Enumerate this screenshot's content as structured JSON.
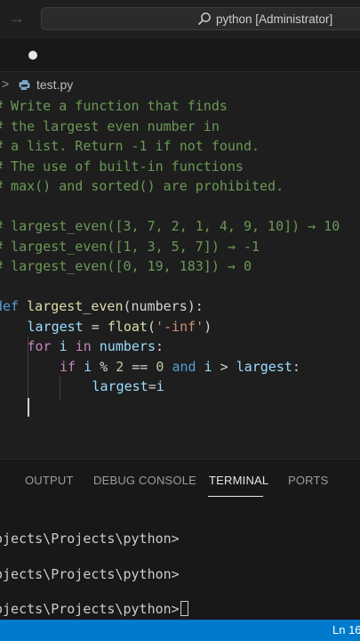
{
  "title_bar": {
    "search_text": "python [Administrator]",
    "nav_icon": "arrow-right-icon",
    "search_icon": "search-icon"
  },
  "tab": {
    "indicator": "unsaved-dot"
  },
  "breadcrumb": {
    "file": "test.py",
    "chevron": ">",
    "file_icon": "python-file-icon"
  },
  "editor": {
    "comments": [
      "# Write a function that finds",
      "# the largest even number in",
      "# a list. Return -1 if not found.",
      "# The use of built-in functions",
      "# max() and sorted() are prohibited.",
      "# largest_even([3, 7, 2, 1, 4, 9, 10]) → 10",
      "# largest_even([1, 3, 5, 7]) → -1",
      "# largest_even([0, 19, 183]) → 0"
    ],
    "def_kw": "def",
    "func_name": "largest_even",
    "def_params": "(numbers):",
    "l2_var": "largest",
    "l2_eq": " = ",
    "l2_func": "float",
    "l2_open": "(",
    "l2_str": "'-inf'",
    "l2_close": ")",
    "l3_for": "for",
    "l3_i": "i",
    "l3_in": "in",
    "l3_numbers": "numbers",
    "l3_colon": ":",
    "l4_if": "if",
    "l4_i": "i",
    "l4_mod": " % ",
    "l4_two": "2",
    "l4_eq": " == ",
    "l4_zero": "0",
    "l4_and": "and",
    "l4_i2": "i",
    "l4_gt": " > ",
    "l4_largest": "largest",
    "l4_colon": ":",
    "l5_largest": "largest",
    "l5_eq": "=",
    "l5_i": "i"
  },
  "panel": {
    "tabs": [
      "OUTPUT",
      "DEBUG CONSOLE",
      "TERMINAL",
      "PORTS"
    ],
    "active_tab": "TERMINAL",
    "terminal_lines": [
      "ojects\\Projects\\python>",
      "ojects\\Projects\\python>",
      "ojects\\Projects\\python>"
    ]
  },
  "status_bar": {
    "position": "Ln 16"
  },
  "colors": {
    "status_bar": "#007acc",
    "comment": "#6a9955",
    "keyword": "#569cd6",
    "control": "#c586c0",
    "function": "#dcdcaa",
    "variable": "#9cdcfe",
    "string": "#ce9178",
    "number": "#b5cea8"
  }
}
